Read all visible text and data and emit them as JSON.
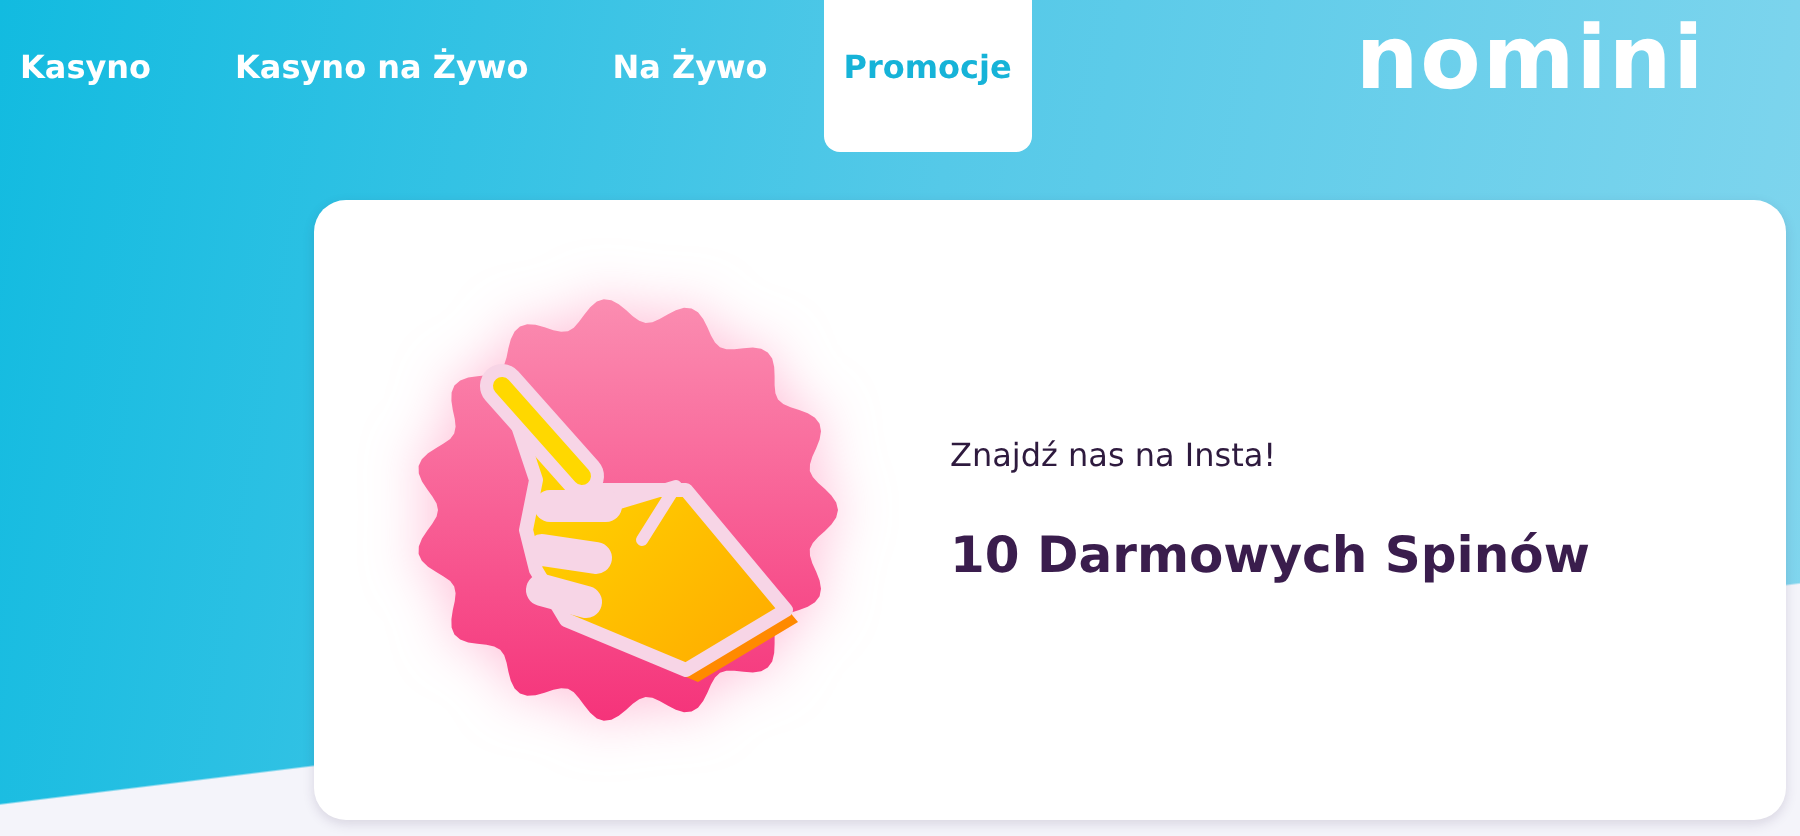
{
  "nav": [
    {
      "label": "Kasyno",
      "selected": false
    },
    {
      "label": "Kasyno na Żywo",
      "selected": false
    },
    {
      "label": "Na Żywo",
      "selected": false
    },
    {
      "label": "Promocje",
      "selected": true
    }
  ],
  "logo": "nomini",
  "promo": {
    "subtitle": "Znajdź nas na Insta!",
    "title": "10 Darmowych Spinów"
  }
}
